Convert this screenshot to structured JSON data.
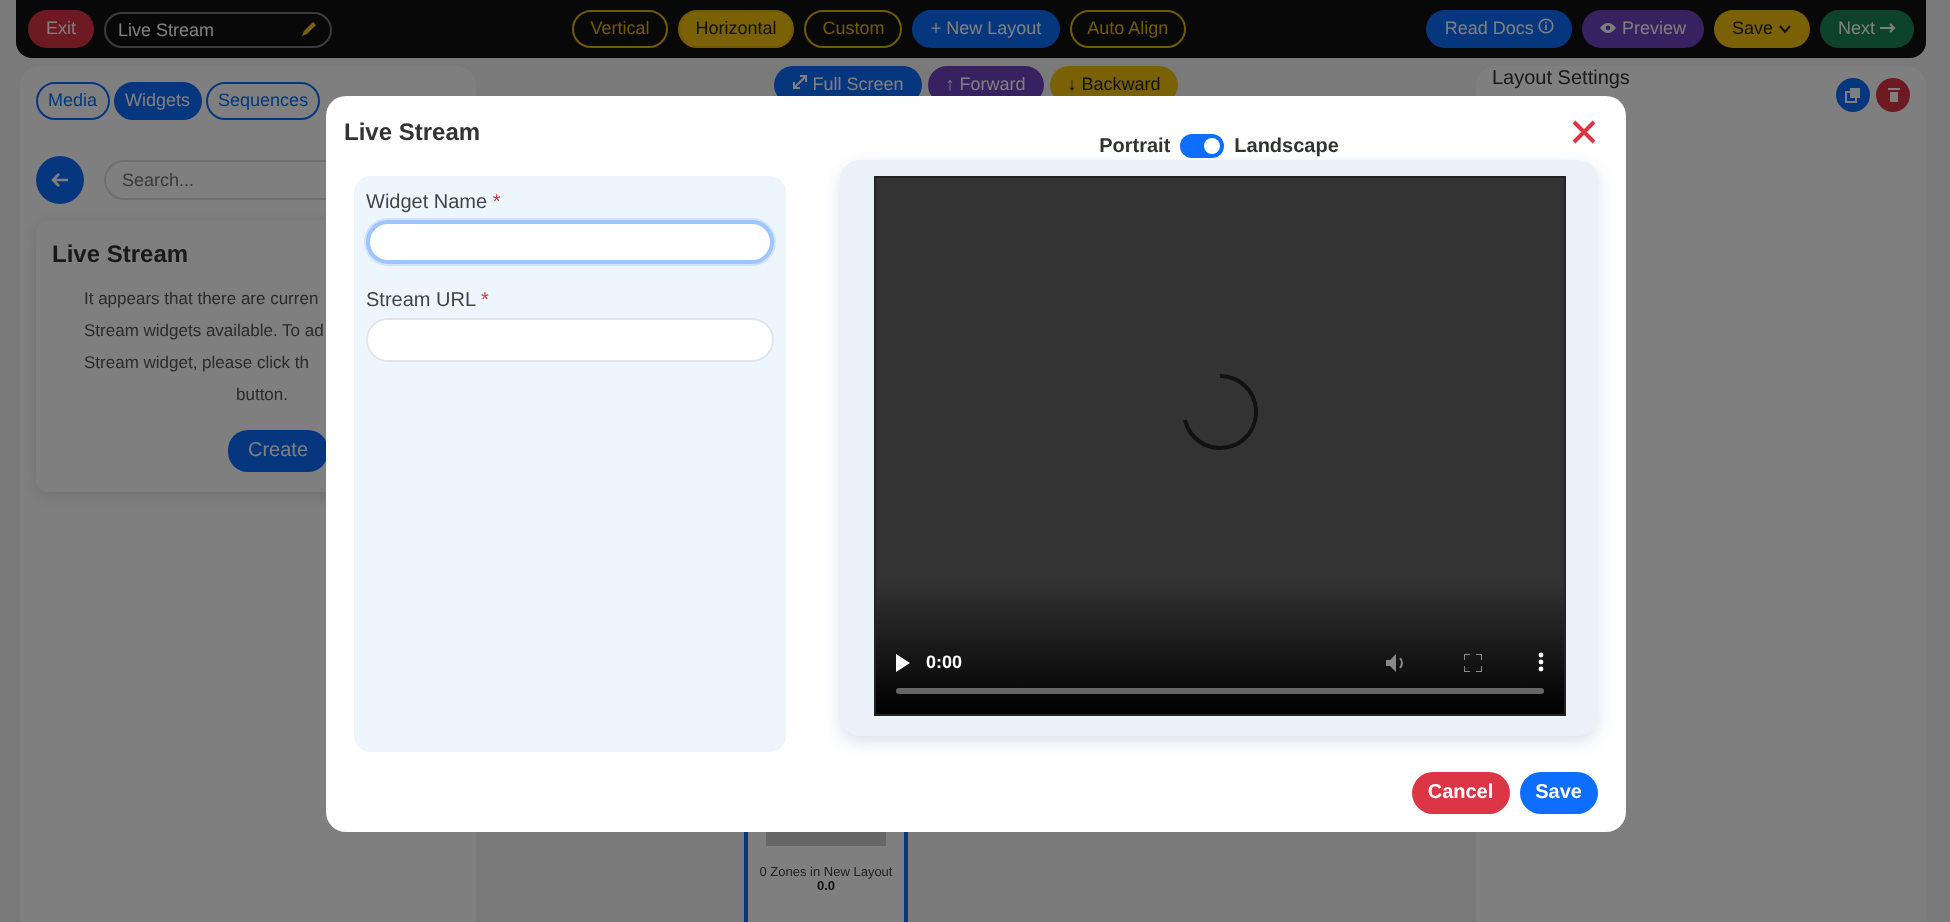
{
  "top_bar": {
    "exit_button": "Exit",
    "layout_name": "Live Stream",
    "orientation_options": [
      {
        "label": "Vertical",
        "selected": false
      },
      {
        "label": "Horizontal",
        "selected": true
      },
      {
        "label": "Custom",
        "selected": false
      }
    ],
    "new_layout_button": "+ New Layout",
    "auto_align_button": "Auto Align",
    "read_docs_button": "Read Docs",
    "preview_button": "Preview",
    "save_button": "Save",
    "next_button": "Next"
  },
  "sidebar": {
    "tabs": [
      {
        "label": "Media",
        "selected": false
      },
      {
        "label": "Widgets",
        "selected": true
      },
      {
        "label": "Sequences",
        "selected": false
      }
    ],
    "search": {
      "placeholder": "Search..."
    },
    "card": {
      "title": "Live Stream",
      "message_lines": [
        "It appears that there are curren",
        "Stream widgets available. To ad",
        "Stream widget, please click th",
        "button."
      ],
      "create_button": "Create"
    }
  },
  "canvas": {
    "toolbar": [
      {
        "label": "Full Screen",
        "kind": "fullscreen"
      },
      {
        "label": "↑ Forward",
        "kind": "forward"
      },
      {
        "label": "↓ Backward",
        "kind": "backward"
      }
    ],
    "layout_thumbnail": {
      "caption": "0 Zones in New Layout",
      "value": "0.0"
    }
  },
  "settings_panel": {
    "title": "Layout Settings"
  },
  "dialog": {
    "title": "Live Stream",
    "fields": [
      {
        "label": "Widget Name",
        "required_mark": "*",
        "focused": true
      },
      {
        "label": "Stream URL",
        "required_mark": "*",
        "focused": false
      }
    ],
    "orientation": {
      "left_label": "Portrait",
      "right_label": "Landscape",
      "on": true
    },
    "video": {
      "time": "0:00",
      "loading": true
    },
    "buttons": [
      {
        "label": "Cancel",
        "kind": "cancel"
      },
      {
        "label": "Save",
        "kind": "primary"
      }
    ]
  }
}
